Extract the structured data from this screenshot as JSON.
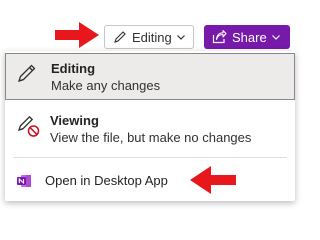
{
  "toolbar": {
    "editing_label": "Editing",
    "share_label": "Share"
  },
  "menu": {
    "items": [
      {
        "title": "Editing",
        "description": "Make any changes",
        "icon": "pencil-icon",
        "selected": true
      },
      {
        "title": "Viewing",
        "description": "View the file, but make no changes",
        "icon": "no-edit-icon",
        "selected": false
      }
    ],
    "desktop": {
      "label": "Open in Desktop App",
      "icon": "onenote-icon"
    }
  },
  "colors": {
    "share_button": "#7719aa",
    "annotation_arrow": "#e8171b",
    "onenote": "#7719aa",
    "selected_item": "#edebe9"
  }
}
